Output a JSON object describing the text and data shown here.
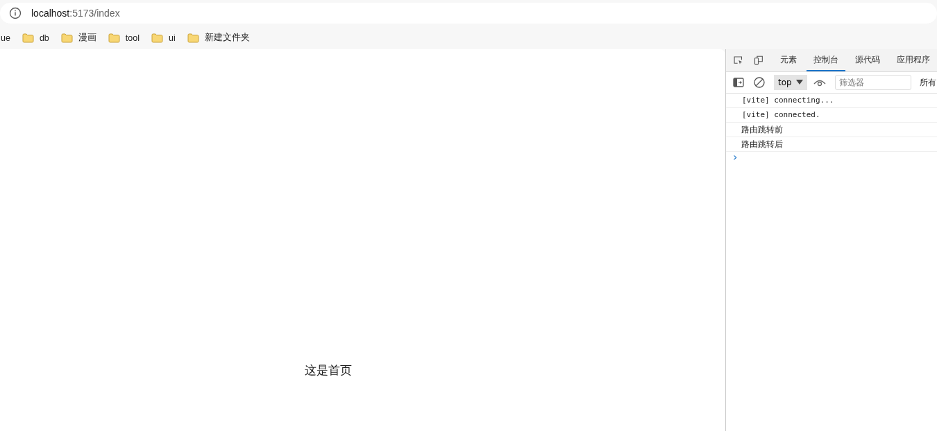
{
  "address_bar": {
    "host": "localhost",
    "path": ":5173/index"
  },
  "bookmarks": [
    {
      "label": "ue",
      "kind": "partial"
    },
    {
      "label": "db",
      "kind": "folder"
    },
    {
      "label": "漫画",
      "kind": "folder"
    },
    {
      "label": "tool",
      "kind": "folder"
    },
    {
      "label": "ui",
      "kind": "folder"
    },
    {
      "label": "新建文件夹",
      "kind": "folder"
    }
  ],
  "page": {
    "text": "这是首页"
  },
  "devtools": {
    "tabs": [
      {
        "label": "元素",
        "selected": false
      },
      {
        "label": "控制台",
        "selected": true
      },
      {
        "label": "源代码",
        "selected": false
      },
      {
        "label": "应用程序",
        "selected": false
      }
    ],
    "context": "top",
    "filter_placeholder": "筛选器",
    "levels": "所有",
    "messages": [
      {
        "text": "[vite] connecting...",
        "kind": "mono"
      },
      {
        "text": "[vite] connected.",
        "kind": "mono"
      },
      {
        "text": "路由跳转前",
        "kind": "text"
      },
      {
        "text": "路由跳转后",
        "kind": "text"
      }
    ],
    "prompt": "›"
  }
}
